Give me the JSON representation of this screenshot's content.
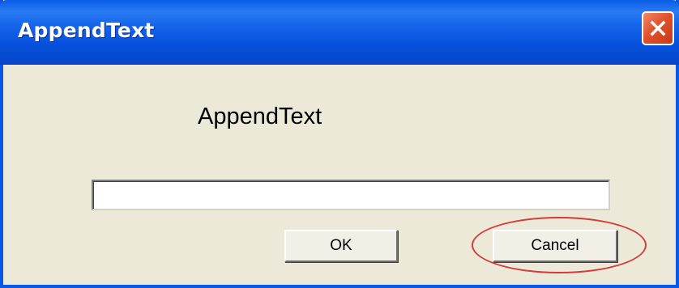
{
  "dialog": {
    "title": "AppendText",
    "prompt_label": "AppendText",
    "input": {
      "value": "",
      "placeholder": ""
    },
    "ok_label": "OK",
    "cancel_label": "Cancel",
    "close_icon": "close-icon",
    "annotation_color": "#D43A3A"
  },
  "theme": {
    "titlebar": "#0A5DE6",
    "window_bg": "#ECE9D8",
    "close_button": "#E0522C"
  }
}
